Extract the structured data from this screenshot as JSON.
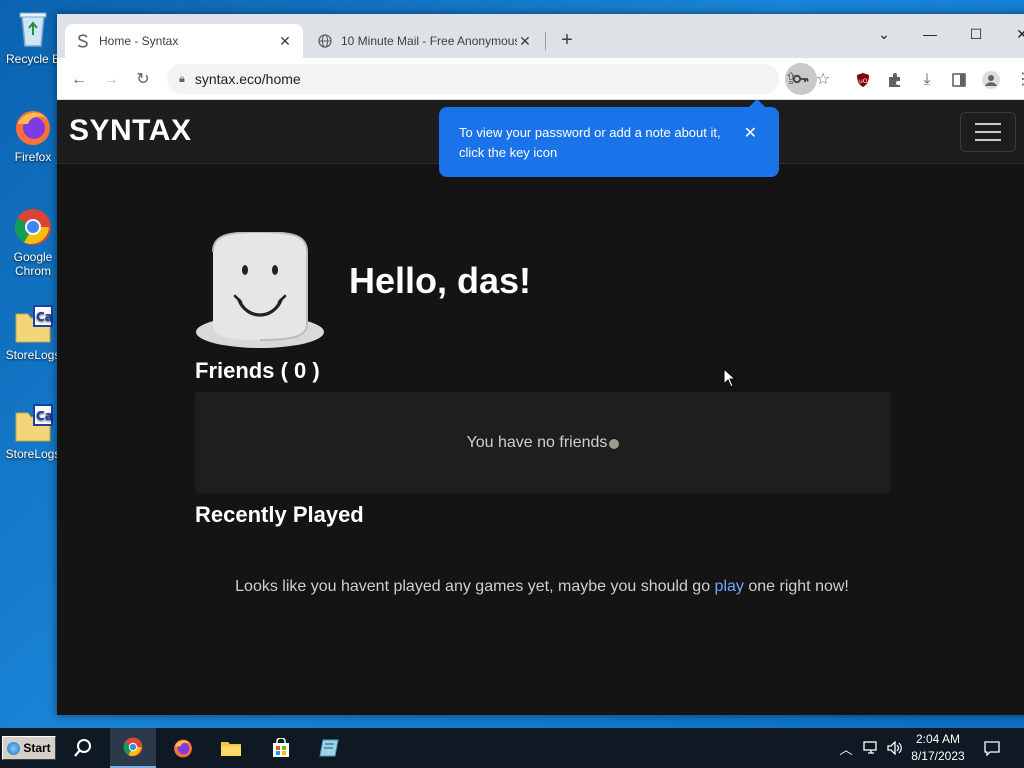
{
  "desktop": {
    "icons": [
      {
        "label": "Recycle B",
        "icon": "recycle-bin-icon"
      },
      {
        "label": "Firefox",
        "icon": "firefox-icon"
      },
      {
        "label": "Google\nChrom",
        "icon": "chrome-icon"
      },
      {
        "label": "StoreLogs",
        "icon": "storelogs-icon"
      },
      {
        "label": "StoreLogs",
        "icon": "storelogs-icon"
      }
    ]
  },
  "browser": {
    "tabs": [
      {
        "title": "Home - Syntax",
        "favicon": "syntax-s-icon",
        "active": true
      },
      {
        "title": "10 Minute Mail - Free Anonymous",
        "favicon": "globe-icon",
        "active": false
      }
    ],
    "url": "syntax.eco/home",
    "password_bubble": "To view your password or add a note about it, click the key icon"
  },
  "site": {
    "brand": "SYNTAX",
    "greeting": "Hello, das!",
    "friends_heading": "Friends ( 0 )",
    "friends_empty": "You have no friends",
    "recent_heading": "Recently Played",
    "recent_empty_before": "Looks like you havent played any games yet, maybe you should go ",
    "recent_empty_link": "play",
    "recent_empty_after": " one right now!",
    "link_color": "#6ea8fe"
  },
  "taskbar": {
    "start_label": "Start",
    "time": "2:04 AM",
    "date": "8/17/2023"
  },
  "colors": {
    "page_bg": "#141414",
    "tooltip_bg": "#1a73e8",
    "desktop_bg": "#0b6bb8"
  }
}
